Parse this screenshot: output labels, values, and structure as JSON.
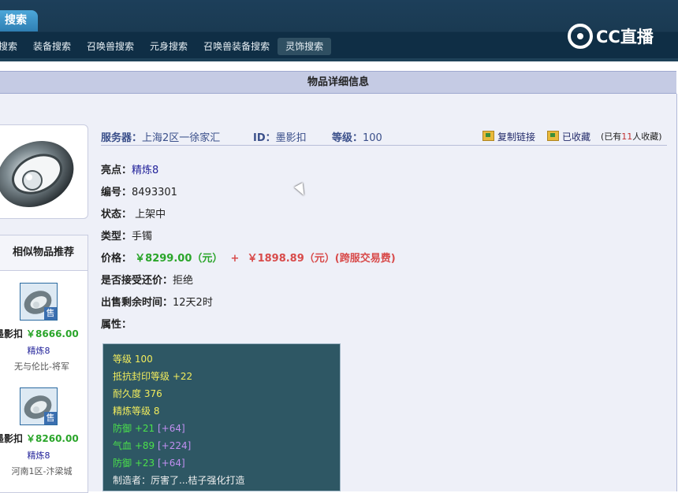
{
  "header": {
    "title_tab": "搜索",
    "logo_text": "CC直播",
    "nav_items": [
      "搜索",
      "装备搜索",
      "召唤兽搜索",
      "元身搜索",
      "召唤兽装备搜索",
      "灵饰搜索"
    ],
    "active_nav": "灵饰搜索"
  },
  "page": {
    "section_title": "物品详细信息"
  },
  "info": {
    "server_label": "服务器：",
    "server_value": "上海2区一徐家汇",
    "id_label": "ID：",
    "id_value": "墨影扣",
    "level_label": "等级：",
    "level_value": "100",
    "copy_link": "复制链接",
    "favorited": "已收藏",
    "fav_count_prefix": "(已有",
    "fav_count": "11",
    "fav_count_suffix": "人收藏)"
  },
  "fields": {
    "highlight_label": "亮点：",
    "highlight_value": "精炼8",
    "serial_label": "编号：",
    "serial_value": "8493301",
    "status_label": "状态：",
    "status_value": "上架中",
    "type_label": "类型：",
    "type_value": "手镯",
    "price_label": "价格：",
    "price_value": "￥8299.00（元）",
    "price_plus": "+",
    "price_fee": "￥1898.89（元）(跨服交易费)",
    "bargain_label": "是否接受还价：",
    "bargain_value": "拒绝",
    "time_label": "出售剩余时间：",
    "time_value": "12天2时",
    "attr_label": "属性："
  },
  "attributes": [
    {
      "text": "等级 100",
      "color": "#f2ec5c"
    },
    {
      "text": "抵抗封印等级 +22",
      "color": "#f2ec5c"
    },
    {
      "text": "耐久度 376",
      "color": "#f2ec5c"
    },
    {
      "text": "精炼等级 8",
      "color": "#f2ec5c"
    },
    {
      "text": "防御 +21",
      "extra": "[+64]",
      "color": "#4be04b"
    },
    {
      "text": "气血 +89",
      "extra": "[+224]",
      "color": "#4be04b"
    },
    {
      "text": "防御 +23",
      "extra": "[+64]",
      "color": "#4be04b"
    },
    {
      "text": "制造者：厉害了...桔子强化打造",
      "color": "#f0f0f0"
    }
  ],
  "similar": {
    "title": "相似物品推荐",
    "items": [
      {
        "name": "墨影扣",
        "price": "￥8666.00",
        "tag": "精炼8",
        "server": "无与伦比-将军",
        "badge": "售"
      },
      {
        "name": "墨影扣",
        "price": "￥8260.00",
        "tag": "精炼8",
        "server": "河南1区-汴梁城",
        "badge": "售"
      }
    ]
  }
}
